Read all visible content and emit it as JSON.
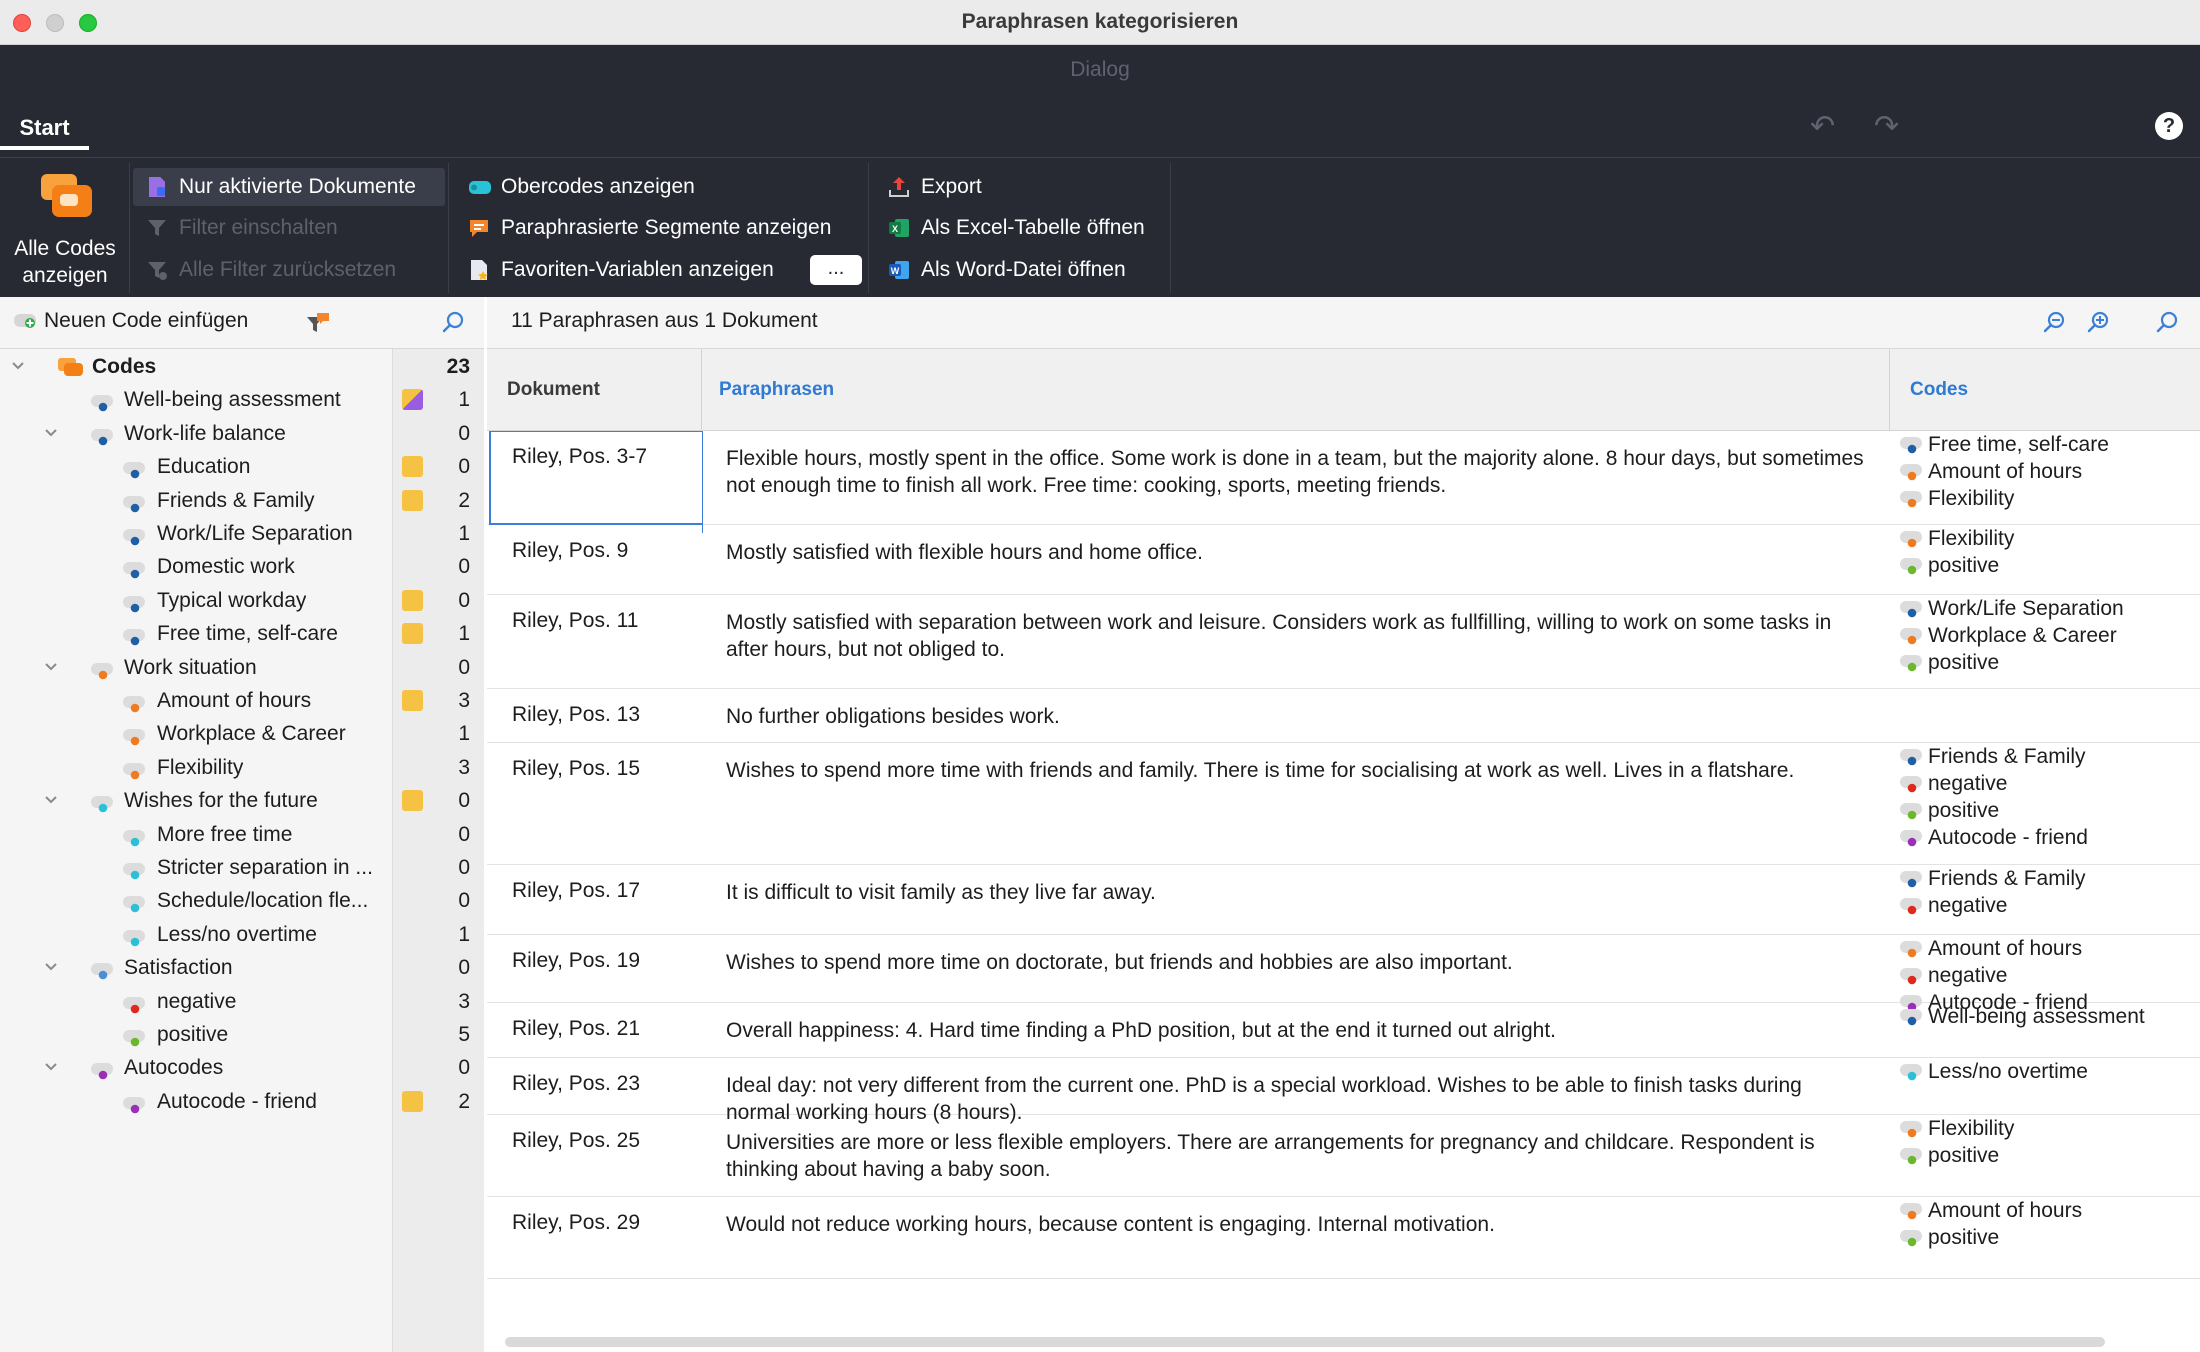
{
  "window": {
    "title": "Paraphrasen kategorisieren",
    "subtitle": "Dialog"
  },
  "ribbon": {
    "tab": "Start",
    "big_button": {
      "label_line1": "Alle Codes",
      "label_line2": "anzeigen"
    },
    "group1": [
      {
        "label": "Nur aktivierte Dokumente",
        "enabled": true,
        "icon": "document-filter-icon"
      },
      {
        "label": "Filter einschalten",
        "enabled": false,
        "icon": "funnel-icon"
      },
      {
        "label": "Alle Filter zurücksetzen",
        "enabled": false,
        "icon": "reset-filter-icon"
      }
    ],
    "group2": [
      {
        "label": "Obercodes anzeigen",
        "icon": "parent-code-icon"
      },
      {
        "label": "Paraphrasierte Segmente anzeigen",
        "icon": "paraphrase-bubble-icon"
      },
      {
        "label": "Favoriten-Variablen anzeigen",
        "icon": "favorite-variables-icon"
      }
    ],
    "more_button": "...",
    "group3": [
      {
        "label": "Export",
        "icon": "export-icon"
      },
      {
        "label": "Als Excel-Tabelle öffnen",
        "icon": "excel-icon"
      },
      {
        "label": "Als Word-Datei öffnen",
        "icon": "word-icon"
      }
    ]
  },
  "left_panel": {
    "new_code_label": "Neuen Code einfügen",
    "tree": [
      {
        "label": "Codes",
        "count": "23",
        "level": 0,
        "expanded": true,
        "bold": true,
        "root": true,
        "memo": ""
      },
      {
        "label": "Well-being assessment",
        "count": "1",
        "level": 1,
        "color": "#1f5fa8",
        "memo": "purple"
      },
      {
        "label": "Work-life balance",
        "count": "0",
        "level": 1,
        "color": "#1f5fa8",
        "expanded": true,
        "memo": ""
      },
      {
        "label": "Education",
        "count": "0",
        "level": 2,
        "color": "#1f5fa8",
        "memo": "yellow"
      },
      {
        "label": "Friends & Family",
        "count": "2",
        "level": 2,
        "color": "#1f5fa8",
        "memo": "yellow"
      },
      {
        "label": "Work/Life Separation",
        "count": "1",
        "level": 2,
        "color": "#1f5fa8",
        "memo": ""
      },
      {
        "label": "Domestic work",
        "count": "0",
        "level": 2,
        "color": "#1f5fa8",
        "memo": ""
      },
      {
        "label": "Typical workday",
        "count": "0",
        "level": 2,
        "color": "#1f5fa8",
        "memo": "yellow"
      },
      {
        "label": "Free time, self-care",
        "count": "1",
        "level": 2,
        "color": "#1f5fa8",
        "memo": "yellow"
      },
      {
        "label": "Work situation",
        "count": "0",
        "level": 1,
        "color": "#f07a1e",
        "expanded": true,
        "memo": ""
      },
      {
        "label": "Amount of hours",
        "count": "3",
        "level": 2,
        "color": "#f07a1e",
        "memo": "yellow"
      },
      {
        "label": "Workplace & Career",
        "count": "1",
        "level": 2,
        "color": "#f07a1e",
        "memo": ""
      },
      {
        "label": "Flexibility",
        "count": "3",
        "level": 2,
        "color": "#f07a1e",
        "memo": ""
      },
      {
        "label": "Wishes for the future",
        "count": "0",
        "level": 1,
        "color": "#2bc0d6",
        "expanded": true,
        "memo": "yellow"
      },
      {
        "label": "More free time",
        "count": "0",
        "level": 2,
        "color": "#2bc0d6",
        "memo": ""
      },
      {
        "label": "Stricter separation in ...",
        "count": "0",
        "level": 2,
        "color": "#2bc0d6",
        "memo": ""
      },
      {
        "label": "Schedule/location fle...",
        "count": "0",
        "level": 2,
        "color": "#2bc0d6",
        "memo": ""
      },
      {
        "label": "Less/no overtime",
        "count": "1",
        "level": 2,
        "color": "#2bc0d6",
        "memo": ""
      },
      {
        "label": "Satisfaction",
        "count": "0",
        "level": 1,
        "color": "#4a90d9",
        "expanded": true,
        "memo": ""
      },
      {
        "label": "negative",
        "count": "3",
        "level": 2,
        "color": "#e0281e",
        "memo": ""
      },
      {
        "label": "positive",
        "count": "5",
        "level": 2,
        "color": "#6bb82c",
        "memo": ""
      },
      {
        "label": "Autocodes",
        "count": "0",
        "level": 1,
        "color": "#9b2fb5",
        "expanded": true,
        "memo": ""
      },
      {
        "label": "Autocode - friend",
        "count": "2",
        "level": 2,
        "color": "#9b2fb5",
        "memo": "yellow"
      }
    ]
  },
  "right_panel": {
    "summary": "11 Paraphrasen aus 1 Dokument",
    "columns": {
      "document": "Dokument",
      "paraphrases": "Paraphrasen",
      "codes": "Codes"
    },
    "rows": [
      {
        "doc": "Riley, Pos. 3-7",
        "text": "Flexible hours, mostly spent in the office. Some work is done in a team, but the majority alone. 8 hour days, but sometimes not enough time to finish all work. Free time: cooking, sports, meeting friends.",
        "codes": [
          {
            "name": "Free time, self-care",
            "color": "#1f5fa8"
          },
          {
            "name": "Amount of hours",
            "color": "#f07a1e"
          },
          {
            "name": "Flexibility",
            "color": "#f07a1e"
          }
        ]
      },
      {
        "doc": "Riley, Pos. 9",
        "text": "Mostly satisfied with flexible hours and home office.",
        "codes": [
          {
            "name": "Flexibility",
            "color": "#f07a1e"
          },
          {
            "name": "positive",
            "color": "#6bb82c"
          }
        ]
      },
      {
        "doc": "Riley, Pos. 11",
        "text": "Mostly satisfied with separation between work and leisure. Considers work as fullfilling, willing to work on some tasks in after hours, but not obliged to.",
        "codes": [
          {
            "name": "Work/Life Separation",
            "color": "#1f5fa8"
          },
          {
            "name": "Workplace & Career",
            "color": "#f07a1e"
          },
          {
            "name": "positive",
            "color": "#6bb82c"
          }
        ]
      },
      {
        "doc": "Riley, Pos. 13",
        "text": "No further obligations besides work.",
        "codes": []
      },
      {
        "doc": "Riley, Pos. 15",
        "text": "Wishes to spend more time with friends and family. There is time for socialising at work as well. Lives in a flatshare.",
        "codes": [
          {
            "name": "Friends & Family",
            "color": "#1f5fa8"
          },
          {
            "name": "negative",
            "color": "#e0281e"
          },
          {
            "name": "positive",
            "color": "#6bb82c"
          },
          {
            "name": "Autocode - friend",
            "color": "#9b2fb5"
          }
        ]
      },
      {
        "doc": "Riley, Pos. 17",
        "text": "It is difficult to visit family as they live far away.",
        "codes": [
          {
            "name": "Friends & Family",
            "color": "#1f5fa8"
          },
          {
            "name": "negative",
            "color": "#e0281e"
          }
        ]
      },
      {
        "doc": "Riley, Pos. 19",
        "text": "Wishes to spend more time on doctorate, but friends and hobbies are also important.",
        "codes": [
          {
            "name": "Amount of hours",
            "color": "#f07a1e"
          },
          {
            "name": "negative",
            "color": "#e0281e"
          },
          {
            "name": "Autocode - friend",
            "color": "#9b2fb5"
          }
        ]
      },
      {
        "doc": "Riley, Pos. 21",
        "text": "Overall happiness: 4. Hard time finding a PhD position, but at the end it turned out alright.",
        "codes": [
          {
            "name": "Well-being assessment",
            "color": "#1f5fa8"
          }
        ]
      },
      {
        "doc": "Riley, Pos. 23",
        "text": "Ideal day: not very different from the current one. PhD is a special workload. Wishes to be able to finish tasks during normal working hours (8 hours).",
        "codes": [
          {
            "name": "Less/no overtime",
            "color": "#2bc0d6"
          }
        ]
      },
      {
        "doc": "Riley, Pos. 25",
        "text": "Universities are more or less flexible employers. There are arrangements for pregnancy and childcare. Respondent is thinking about having a baby soon.",
        "codes": [
          {
            "name": "Flexibility",
            "color": "#f07a1e"
          },
          {
            "name": "positive",
            "color": "#6bb82c"
          }
        ]
      },
      {
        "doc": "Riley, Pos. 29",
        "text": "Would not reduce working hours, because content is engaging. Internal motivation.",
        "codes": [
          {
            "name": "Amount of hours",
            "color": "#f07a1e"
          },
          {
            "name": "positive",
            "color": "#6bb82c"
          }
        ]
      }
    ]
  }
}
